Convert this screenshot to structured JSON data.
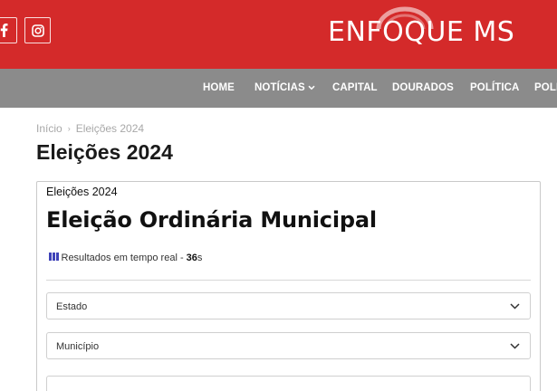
{
  "header": {
    "brand": "ENFOQUE MS",
    "colors": {
      "bar": "#d42a2a",
      "nav": "#8b8b8b",
      "accent": "#3f43b8"
    },
    "social": [
      {
        "icon": "facebook-icon"
      },
      {
        "icon": "instagram-icon"
      }
    ]
  },
  "nav": {
    "items": [
      {
        "label": "HOME"
      },
      {
        "label": "NOTÍCIAS",
        "has_dropdown": true
      },
      {
        "label": "CAPITAL"
      },
      {
        "label": "DOURADOS"
      },
      {
        "label": "POLÍTICA"
      },
      {
        "label": "POLI"
      }
    ]
  },
  "breadcrumb": {
    "home": "Início",
    "separator": "›",
    "current": "Eleições 2024"
  },
  "page": {
    "title": "Eleições 2024"
  },
  "widget": {
    "eyebrow": "Eleições 2024",
    "heading": "Eleição Ordinária Municipal",
    "live_text": "Resultados em tempo real - ",
    "live_count": "36",
    "live_unit": "s",
    "selects": [
      {
        "label": "Estado"
      },
      {
        "label": "Município"
      }
    ]
  }
}
